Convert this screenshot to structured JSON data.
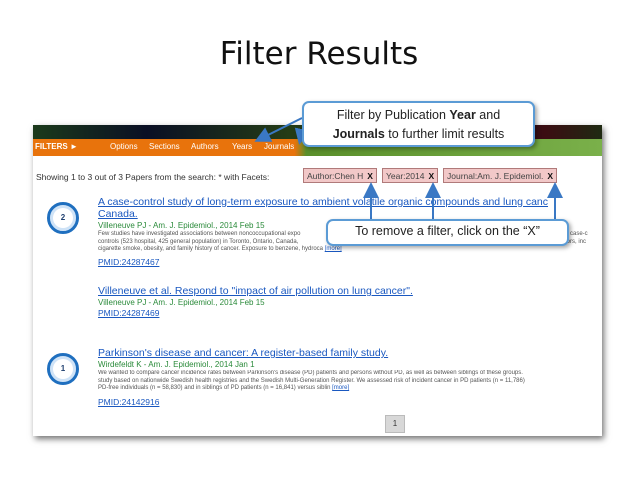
{
  "slide": {
    "title": "Filter Results"
  },
  "nav": {
    "filters_label": "FILTERS ►",
    "items": [
      "Options",
      "Sections",
      "Authors",
      "Years",
      "Journals"
    ]
  },
  "results": {
    "showing_text": "Showing 1 to 3 out of 3 Papers from the search:  * with Facets:",
    "facets": [
      {
        "label": "Author:Chen H",
        "remove": "X"
      },
      {
        "label": "Year:2014",
        "remove": "X"
      },
      {
        "label": "Journal:Am. J. Epidemiol.",
        "remove": "X"
      }
    ]
  },
  "papers": [
    {
      "badge": "2",
      "title_line1": "A case-control study of long-term exposure to ambient volatile organic compounds and lung canc",
      "title_line2": "Canada.",
      "meta": "Villeneuve PJ - Am. J. Epidemiol., 2014 Feb 15",
      "abstract_line1": "Few studies have investigated associations between noncoccupational expo",
      "abstract_line2": "controls (523 hospital, 425 general population) in Toronto, Ontario, Canada,",
      "abstract_line3": "cigarette smoke, obesity, and family history of cancer. Exposure to benzene, hydroca",
      "abstract_right1": "a case-c",
      "abstract_right2": "tors, inc",
      "more": "[more]",
      "pmid": "PMID:24287467"
    },
    {
      "title_line1": "Villeneuve et al. Respond to \"impact of air pollution on lung cancer\".",
      "meta": "Villeneuve PJ - Am. J. Epidemiol., 2014 Feb 15",
      "pmid": "PMID:24287469"
    },
    {
      "badge": "1",
      "title_line1": "Parkinson's disease and cancer: A register-based family study.",
      "meta": "Wirdefeldt K - Am. J. Epidemiol., 2014 Jan 1",
      "abstract_line1": "We wanted to compare cancer incidence rates between Parkinson's disease (PD) patients and persons without PD, as well as between siblings of these groups.",
      "abstract_line2": "study based on nationwide Swedish health registries and the Swedish Multi-Generation Register. We assessed risk of incident cancer in PD patients (n = 11,786)",
      "abstract_line3": "PD-free individuals (n = 58,830) and in siblings of PD patients (n = 16,841) versus siblin",
      "more": "[more]",
      "pmid": "PMID:24142916"
    }
  ],
  "pagination": {
    "current": "1"
  },
  "callouts": {
    "filter_pre": "Filter by Publication ",
    "filter_year": "Year",
    "filter_and": " and",
    "filter_journals": "Journals",
    "filter_post": " to further limit results",
    "remove": "To remove a filter, click on the “X”"
  },
  "colors": {
    "callout_border": "#5b9bd5",
    "link": "#1a58c0",
    "meta_green": "#2a8a3a",
    "facet_bg": "#f2c8c8",
    "nav_orange": "#e8730c"
  }
}
